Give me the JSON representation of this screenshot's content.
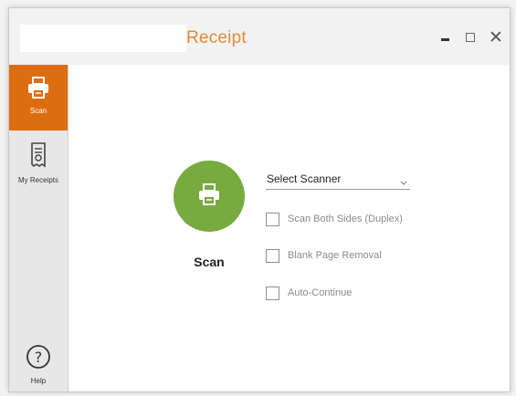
{
  "window": {
    "title": "Receipt",
    "accent_color": "#e48a3a"
  },
  "sidebar": {
    "active_color": "#dd6d11",
    "items": [
      {
        "label": "Scan",
        "icon": "printer-icon",
        "active": true
      },
      {
        "label": "My Receipts",
        "icon": "receipt-icon",
        "active": false
      },
      {
        "label": "Help",
        "icon": "help-icon",
        "active": false
      }
    ]
  },
  "main": {
    "scan_button": {
      "label": "Scan",
      "color": "#77aa3f",
      "icon": "printer-icon"
    },
    "scanner_select": {
      "value": "Select Scanner"
    },
    "options": [
      {
        "label": "Scan Both Sides (Duplex)",
        "checked": false
      },
      {
        "label": "Blank Page Removal",
        "checked": false
      },
      {
        "label": "Auto-Continue",
        "checked": false
      }
    ]
  }
}
